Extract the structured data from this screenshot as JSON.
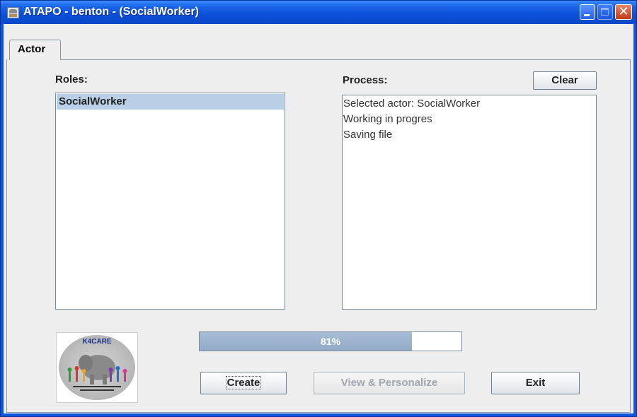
{
  "window": {
    "title": "ATAPO - benton - (SocialWorker)"
  },
  "tabs": [
    {
      "label": "Actor",
      "selected": true
    }
  ],
  "roles": {
    "label": "Roles:",
    "items": [
      "SocialWorker"
    ],
    "selected": "SocialWorker"
  },
  "process": {
    "label": "Process:",
    "clear_label": "Clear",
    "lines": [
      "Selected actor: SocialWorker",
      "Working in progres",
      "Saving file"
    ]
  },
  "progress": {
    "value": 81,
    "text": "81%"
  },
  "buttons": {
    "create": "Create",
    "view": "View & Personalize",
    "exit": "Exit"
  },
  "logo": {
    "name": "K4CARE"
  },
  "icons": {
    "app": "app-icon",
    "minimize": "minimize-icon",
    "maximize": "maximize-icon",
    "close": "close-icon"
  },
  "colors": {
    "titlebar": "#0b4fd8",
    "selection": "#b8cfe5",
    "progress_fill": "#93abc8",
    "close_button": "#c23a16"
  }
}
